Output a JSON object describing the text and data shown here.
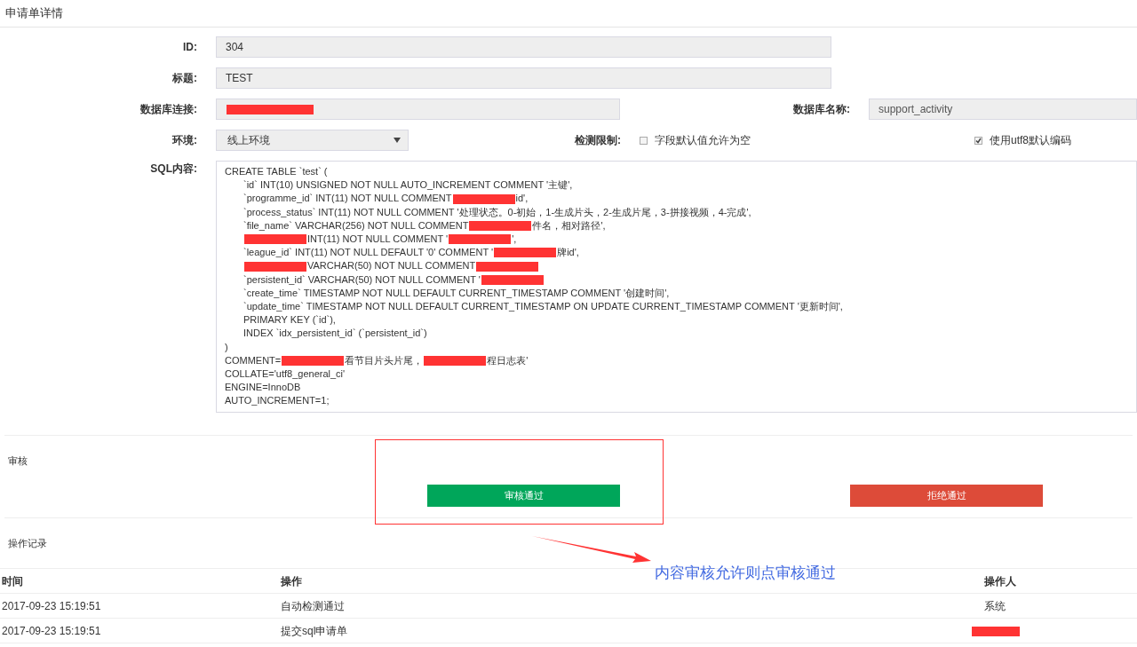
{
  "page_title": "申请单详情",
  "form": {
    "id": {
      "label": "ID:",
      "value": "304"
    },
    "title": {
      "label": "标题:",
      "value": "TEST"
    },
    "db_link": {
      "label": "数据库连接:",
      "redacted": true
    },
    "db_name": {
      "label": "数据库名称:",
      "value": "support_activity"
    },
    "env": {
      "label": "环境:",
      "value": "线上环境"
    },
    "check": {
      "label": "检测限制:",
      "options": [
        {
          "label": "字段默认值允许为空",
          "checked": false
        },
        {
          "label": "使用utf8默认编码",
          "checked": true
        }
      ]
    },
    "sql": {
      "label": "SQL内容:",
      "lines": [
        {
          "indent": false,
          "parts": [
            {
              "kind": "text",
              "text": "CREATE TABLE `test` ("
            }
          ]
        },
        {
          "indent": true,
          "parts": [
            {
              "kind": "text",
              "text": "`id` INT(10) UNSIGNED NOT NULL AUTO_INCREMENT COMMENT '主键',"
            }
          ]
        },
        {
          "indent": true,
          "parts": [
            {
              "kind": "text",
              "text": "`programme_id` INT(11) NOT NULL COMMENT"
            },
            {
              "kind": "redaction"
            },
            {
              "kind": "text",
              "text": "id',"
            }
          ]
        },
        {
          "indent": true,
          "parts": [
            {
              "kind": "text",
              "text": "`process_status` INT(11) NOT NULL COMMENT '处理状态。0-初始，1-生成片头，2-生成片尾，3-拼接视频，4-完成',"
            }
          ]
        },
        {
          "indent": true,
          "parts": [
            {
              "kind": "text",
              "text": "`file_name` VARCHAR(256) NOT NULL COMMENT"
            },
            {
              "kind": "redaction"
            },
            {
              "kind": "text",
              "text": "件名，相对路径',"
            }
          ]
        },
        {
          "indent": true,
          "parts": [
            {
              "kind": "redaction"
            },
            {
              "kind": "text",
              "text": "INT(11) NOT NULL COMMENT '"
            },
            {
              "kind": "redaction"
            },
            {
              "kind": "text",
              "text": "',"
            }
          ]
        },
        {
          "indent": true,
          "parts": [
            {
              "kind": "text",
              "text": "`league_id` INT(11) NOT NULL DEFAULT '0' COMMENT '"
            },
            {
              "kind": "redaction"
            },
            {
              "kind": "text",
              "text": "牌id',"
            }
          ]
        },
        {
          "indent": true,
          "parts": [
            {
              "kind": "redaction"
            },
            {
              "kind": "text",
              "text": "VARCHAR(50) NOT NULL COMMENT"
            },
            {
              "kind": "redaction"
            }
          ]
        },
        {
          "indent": true,
          "parts": [
            {
              "kind": "text",
              "text": "`persistent_id` VARCHAR(50) NOT NULL COMMENT '"
            },
            {
              "kind": "redaction"
            }
          ]
        },
        {
          "indent": true,
          "parts": [
            {
              "kind": "text",
              "text": "`create_time` TIMESTAMP NOT NULL DEFAULT CURRENT_TIMESTAMP COMMENT '创建时间',"
            }
          ]
        },
        {
          "indent": true,
          "parts": [
            {
              "kind": "text",
              "text": "`update_time` TIMESTAMP NOT NULL DEFAULT CURRENT_TIMESTAMP ON UPDATE CURRENT_TIMESTAMP COMMENT '更新时间',"
            }
          ]
        },
        {
          "indent": true,
          "parts": [
            {
              "kind": "text",
              "text": "PRIMARY KEY (`id`),"
            }
          ]
        },
        {
          "indent": true,
          "parts": [
            {
              "kind": "text",
              "text": "INDEX `idx_persistent_id` (`persistent_id`)"
            }
          ]
        },
        {
          "indent": false,
          "parts": [
            {
              "kind": "text",
              "text": ")"
            }
          ]
        },
        {
          "indent": false,
          "parts": [
            {
              "kind": "text",
              "text": "COMMENT="
            },
            {
              "kind": "redaction"
            },
            {
              "kind": "text",
              "text": "看节目片头片尾，"
            },
            {
              "kind": "redaction"
            },
            {
              "kind": "text",
              "text": "程日志表'"
            }
          ]
        },
        {
          "indent": false,
          "parts": [
            {
              "kind": "text",
              "text": "COLLATE='utf8_general_ci'"
            }
          ]
        },
        {
          "indent": false,
          "parts": [
            {
              "kind": "text",
              "text": "ENGINE=InnoDB"
            }
          ]
        },
        {
          "indent": false,
          "parts": [
            {
              "kind": "text",
              "text": "AUTO_INCREMENT=1;"
            }
          ]
        }
      ]
    }
  },
  "review": {
    "label": "审核",
    "approve": "审核通过",
    "reject": "拒绝通过"
  },
  "log": {
    "label": "操作记录",
    "columns": [
      "时间",
      "操作",
      "操作人"
    ],
    "rows": [
      {
        "time": "2017-09-23 15:19:51",
        "action": "自动检测通过",
        "operator": "系统",
        "operator_redacted": false
      },
      {
        "time": "2017-09-23 15:19:51",
        "action": "提交sql申请单",
        "operator_redacted": true
      }
    ]
  },
  "annotation": {
    "text": "内容审核允许则点审核通过"
  }
}
